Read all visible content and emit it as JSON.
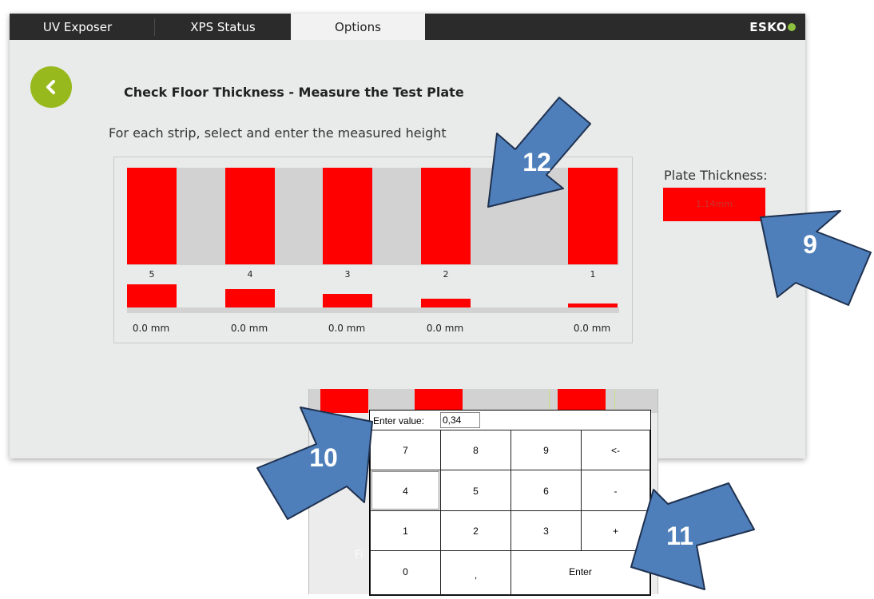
{
  "tabs": [
    {
      "label": "UV Exposer"
    },
    {
      "label": "XPS Status"
    },
    {
      "label": "Options"
    }
  ],
  "brand": {
    "name": "ESKO",
    "accent": "#8cc03e"
  },
  "page": {
    "title": "Check Floor Thickness - Measure the Test Plate",
    "instruction": "For each strip, select and enter the measured height"
  },
  "strips": [
    {
      "number": "5",
      "value": "0.0 mm"
    },
    {
      "number": "4",
      "value": "0.0 mm"
    },
    {
      "number": "3",
      "value": "0.0 mm"
    },
    {
      "number": "2",
      "value": "0.0 mm"
    },
    {
      "number": "1",
      "value": "0.0 mm"
    }
  ],
  "plate": {
    "label": "Plate Thickness:",
    "value": "1.14mm"
  },
  "keypad": {
    "entry_label": "Enter value:",
    "entry_value": "0,34",
    "keys": [
      "7",
      "8",
      "9",
      "<-",
      "4",
      "5",
      "6",
      "-",
      "1",
      "2",
      "3",
      "+",
      "0",
      ",",
      "Enter"
    ],
    "background_text": "Fi"
  },
  "callouts": [
    "12",
    "9",
    "10",
    "11"
  ],
  "colors": {
    "strip_red": "#ff0000",
    "accent_green": "#98b91d",
    "callout_blue": "#4e7fba",
    "topbar": "#2b2b2b"
  }
}
